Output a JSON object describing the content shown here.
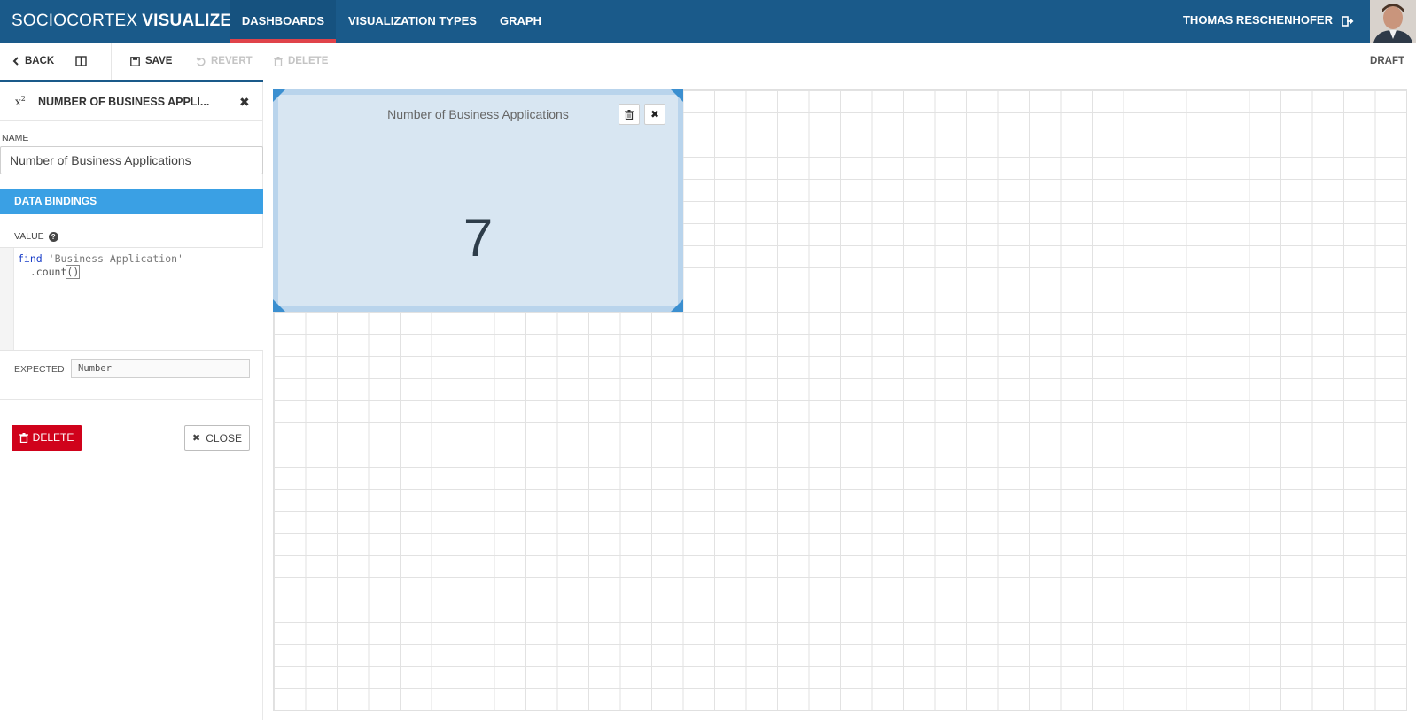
{
  "brand": {
    "light": "SOCIOCORTEX",
    "bold": "VISUALIZER"
  },
  "nav": {
    "items": [
      "DASHBOARDS",
      "VISUALIZATION TYPES",
      "GRAPH"
    ],
    "active_index": 0
  },
  "user": {
    "name": "THOMAS RESCHENHOFER",
    "logout_icon": "sign-out-icon",
    "avatar_icon": "user-photo"
  },
  "toolbar": {
    "back": "BACK",
    "layout_toggle_icon": "columns-icon",
    "save": "SAVE",
    "revert": "REVERT",
    "delete": "DELETE",
    "status": "DRAFT"
  },
  "panel": {
    "icon": "x²",
    "title": "NUMBER OF BUSINESS APPLI...",
    "close_icon": "times-icon",
    "name_label": "NAME",
    "name_value": "Number of Business Applications",
    "section_title": "DATA BINDINGS",
    "value_label": "VALUE",
    "code": {
      "line1_keyword": "find",
      "line1_string": "'Business Application'",
      "line2_method": ".count",
      "line2_brackets": "()"
    },
    "expected_label": "EXPECTED",
    "expected_value": "Number",
    "delete_button": "DELETE",
    "close_button": "CLOSE"
  },
  "widget": {
    "title": "Number of Business Applications",
    "value": "7",
    "delete_icon": "trash-icon",
    "close_icon": "times-icon"
  },
  "colors": {
    "navbar": "#1a5a8a",
    "nav_active_underline": "#e0434a",
    "section_header": "#3aa0e4",
    "delete_button": "#d0021b",
    "widget_bg": "#d8e6f2",
    "widget_corner": "#3b8fd0"
  }
}
